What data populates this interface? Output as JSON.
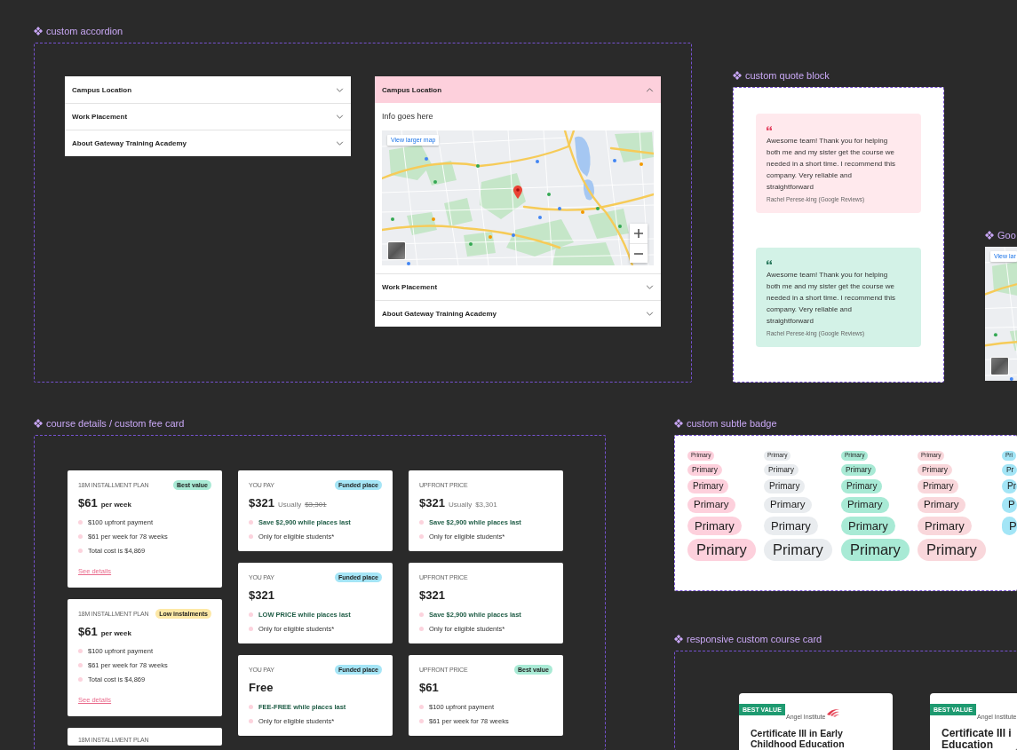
{
  "accordion_section": {
    "label": "custom accordion",
    "accordions": [
      {
        "items": [
          {
            "title": "Campus Location",
            "expanded": false
          },
          {
            "title": "Work Placement",
            "expanded": false
          },
          {
            "title": "About Gateway Training Academy",
            "expanded": false
          }
        ]
      },
      {
        "items": [
          {
            "title": "Campus Location",
            "expanded": true,
            "body": "Info goes here",
            "map": {
              "button": "View larger map"
            }
          },
          {
            "title": "Work Placement",
            "expanded": false
          },
          {
            "title": "About Gateway Training Academy",
            "expanded": false
          }
        ]
      }
    ]
  },
  "quote_section": {
    "label": "custom quote block",
    "quotes": [
      {
        "text": "Awesome team! Thank you for helping both me and my sister get the course we needed in a short time. I recommend this company. Very reliable and straightforward",
        "author": "Rachel Perese-king (Google Reviews)",
        "color": "#ffe9ed"
      },
      {
        "text": "Awesome team! Thank you for helping both me and my sister get the course we needed in a short time. I recommend this company. Very reliable and straightforward",
        "author": "Rachel Perese-king (Google Reviews)",
        "color": "#d3f2e7"
      }
    ]
  },
  "map_section": {
    "label": "Goo",
    "map": {
      "button": "View lar"
    }
  },
  "fee_section": {
    "label": "course details / custom fee card",
    "columns": [
      {
        "cards": [
          {
            "eyebrow": "18M INSTALLMENT PLAN",
            "badge": {
              "label": "Best value",
              "color": "#a9ead5"
            },
            "price": "$61",
            "unit": "per week",
            "bullets": [
              {
                "text": "$100 upfront payment",
                "emphasis": false
              },
              {
                "text": "$61 per week for 78 weeks",
                "emphasis": false
              },
              {
                "text": "Total cost is $4,869",
                "emphasis": false
              }
            ],
            "link": "See details"
          },
          {
            "eyebrow": "18M INSTALLMENT PLAN",
            "badge": {
              "label": "Low instalments",
              "color": "#fde8a6"
            },
            "price": "$61",
            "unit": "per week",
            "bullets": [
              {
                "text": "$100 upfront payment",
                "emphasis": false
              },
              {
                "text": "$61 per week for 78 weeks",
                "emphasis": false
              },
              {
                "text": "Total cost is $4,869",
                "emphasis": false
              }
            ],
            "link": "See details"
          },
          {
            "eyebrow": "18M INSTALLMENT PLAN"
          }
        ]
      },
      {
        "cards": [
          {
            "eyebrow": "YOU PAY",
            "badge": {
              "label": "Funded place",
              "color": "#a5e5f6"
            },
            "price": "$321",
            "note": "Usually",
            "was": "$3,301",
            "struck": true,
            "bullets": [
              {
                "text": "Save $2,900 while places last",
                "emphasis": true
              },
              {
                "text": "Only for eligible students*",
                "emphasis": false
              }
            ]
          },
          {
            "eyebrow": "YOU PAY",
            "badge": {
              "label": "Funded place",
              "color": "#a5e5f6"
            },
            "price": "$321",
            "bullets": [
              {
                "text": "LOW PRICE while places last",
                "emphasis": true
              },
              {
                "text": "Only for eligible students*",
                "emphasis": false
              }
            ]
          },
          {
            "eyebrow": "YOU PAY",
            "badge": {
              "label": "Funded place",
              "color": "#a5e5f6"
            },
            "price": "Free",
            "bullets": [
              {
                "text": "FEE-FREE while places last",
                "emphasis": true
              },
              {
                "text": "Only for eligible students*",
                "emphasis": false
              }
            ]
          }
        ]
      },
      {
        "cards": [
          {
            "eyebrow": "UPFRONT PRICE",
            "price": "$321",
            "note": "Usually",
            "was": "$3,301",
            "struck": false,
            "bullets": [
              {
                "text": "Save $2,900 while places last",
                "emphasis": true
              },
              {
                "text": "Only for eligible students*",
                "emphasis": false
              }
            ]
          },
          {
            "eyebrow": "UPFRONT PRICE",
            "price": "$321",
            "bullets": [
              {
                "text": "Save $2,900 while places last",
                "emphasis": true
              },
              {
                "text": "Only for eligible students*",
                "emphasis": false
              }
            ]
          },
          {
            "eyebrow": "UPFRONT PRICE",
            "badge": {
              "label": "Best value",
              "color": "#a9ead5"
            },
            "price": "$61",
            "bullets": [
              {
                "text": "$100 upfront payment",
                "emphasis": false
              },
              {
                "text": "$61 per week for 78 weeks",
                "emphasis": false
              }
            ]
          }
        ]
      }
    ]
  },
  "badge_section": {
    "label": "custom subtle badge",
    "columns": [
      {
        "color": "#fdd0dc",
        "badges": [
          "Primary",
          "Primary",
          "Primary",
          "Primary",
          "Primary",
          "Primary"
        ]
      },
      {
        "color": "#e9ecef",
        "badges": [
          "Primary",
          "Primary",
          "Primary",
          "Primary",
          "Primary",
          "Primary"
        ]
      },
      {
        "color": "#a8ead5",
        "badges": [
          "Primary",
          "Primary",
          "Primary",
          "Primary",
          "Primary",
          "Primary"
        ]
      },
      {
        "color": "#f9d7db",
        "badges": [
          "Primary",
          "Primary",
          "Primary",
          "Primary",
          "Primary",
          "Primary"
        ]
      },
      {
        "color": "#a3e5f6",
        "badges": [
          "Pri",
          "Pr",
          "Pr",
          "P",
          "P"
        ]
      }
    ]
  },
  "course_section": {
    "label": "responsive custom course card",
    "cards": [
      {
        "ribbon": "BEST VALUE",
        "logo": "Angel Institute",
        "title_lines": [
          "Certificate III in Early",
          "Childhood Education"
        ]
      },
      {
        "ribbon": "BEST VALUE",
        "logo": "Angel Institute",
        "title_lines": [
          "Certificate III i",
          "Education"
        ]
      }
    ]
  }
}
